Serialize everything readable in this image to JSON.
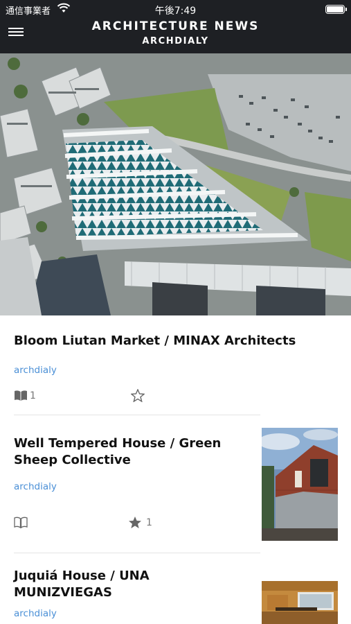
{
  "status_bar": {
    "carrier": "通信事業者",
    "time": "午後7:49"
  },
  "header": {
    "title": "ARCHITECTURE NEWS",
    "subtitle": "ARCHDIALY"
  },
  "articles": [
    {
      "title": "Bloom Liutan Market / MINAX Architects",
      "source": "archdialy",
      "read_count": "1",
      "star_count": ""
    },
    {
      "title_line1": "Well Tempered House / Green",
      "title_line2": "Sheep Collective",
      "source": "archdialy",
      "read_count": "",
      "star_count": "1"
    },
    {
      "title_line1": "Juquiá House / UNA",
      "title_line2": "MUNIZVIEGAS",
      "source": "archdialy"
    }
  ],
  "icons": {
    "menu": "hamburger-menu-icon",
    "wifi": "wifi-icon",
    "battery": "battery-icon",
    "read": "book-icon",
    "favorite": "star-icon"
  }
}
